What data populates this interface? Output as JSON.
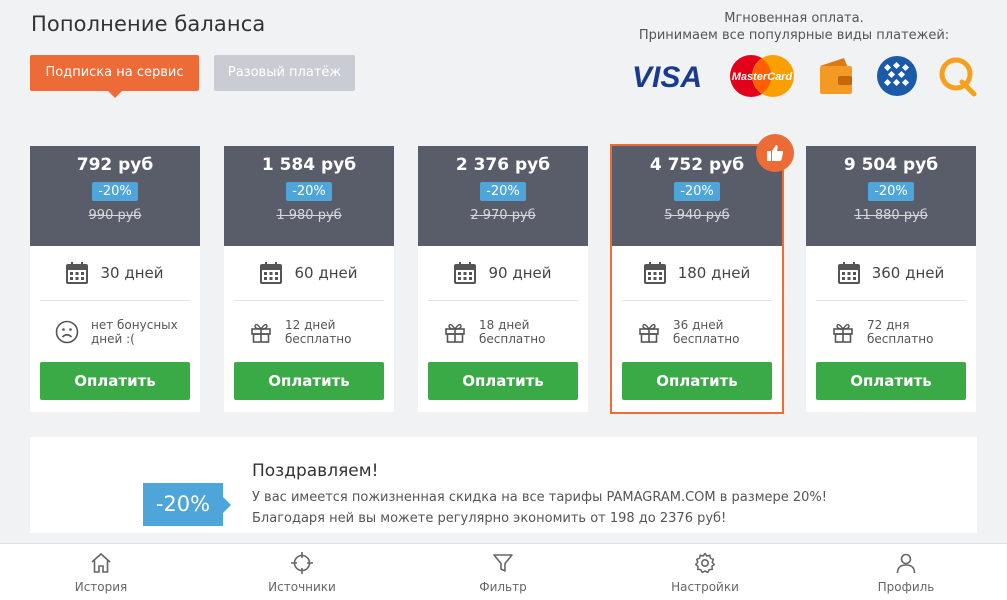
{
  "page": {
    "title": "Пополнение баланса"
  },
  "tabs": {
    "subscription": "Подписка на сервис",
    "one_time": "Разовый платёж"
  },
  "payment_info": {
    "line1": "Мгновенная оплата.",
    "line2": "Принимаем все популярные виды платежей:"
  },
  "logos": [
    {
      "name": "visa-logo",
      "text": "VISA"
    },
    {
      "name": "mastercard-logo",
      "text": "MasterCard"
    },
    {
      "name": "wallet-logo",
      "text": ""
    },
    {
      "name": "webmoney-logo",
      "text": ""
    },
    {
      "name": "qiwi-logo",
      "text": ""
    }
  ],
  "cards": [
    {
      "price": "792 руб",
      "discount": "-20%",
      "old_price": "990 руб",
      "days": "30 дней",
      "bonus_line1": "нет бонусных",
      "bonus_line2": "дней :(",
      "bonus_icon": "sad-face-icon",
      "button": "Оплатить"
    },
    {
      "price": "1 584 руб",
      "discount": "-20%",
      "old_price": "1 980 руб",
      "days": "60 дней",
      "bonus_line1": "12 дней",
      "bonus_line2": "бесплатно",
      "bonus_icon": "gift-icon",
      "button": "Оплатить"
    },
    {
      "price": "2 376 руб",
      "discount": "-20%",
      "old_price": "2 970 руб",
      "days": "90 дней",
      "bonus_line1": "18 дней",
      "bonus_line2": "бесплатно",
      "bonus_icon": "gift-icon",
      "button": "Оплатить"
    },
    {
      "price": "4 752 руб",
      "discount": "-20%",
      "old_price": "5 940 руб",
      "days": "180 дней",
      "bonus_line1": "36 дней",
      "bonus_line2": "бесплатно",
      "bonus_icon": "gift-icon",
      "button": "Оплатить"
    },
    {
      "price": "9 504 руб",
      "discount": "-20%",
      "old_price": "11 880 руб",
      "days": "360 дней",
      "bonus_line1": "72 дня",
      "bonus_line2": "бесплатно",
      "bonus_icon": "gift-icon",
      "button": "Оплатить"
    }
  ],
  "congrats": {
    "discount": "-20%",
    "title": "Поздравляем!",
    "line1": "У вас имеется пожизненная скидка на все тарифы PAMAGRAM.COM в размере 20%!",
    "line2": "Благодаря ней вы можете регулярно экономить от 198 до 2376 руб!"
  },
  "nav": [
    {
      "label": "История",
      "icon": "home-icon"
    },
    {
      "label": "Источники",
      "icon": "crosshair-icon"
    },
    {
      "label": "Фильтр",
      "icon": "filter-icon"
    },
    {
      "label": "Настройки",
      "icon": "gear-icon"
    },
    {
      "label": "Профиль",
      "icon": "user-icon"
    }
  ],
  "colors": {
    "accent": "#ec6b37",
    "pay_button": "#3aaa46",
    "discount": "#4ea5d9",
    "card_header": "#595d6a"
  }
}
